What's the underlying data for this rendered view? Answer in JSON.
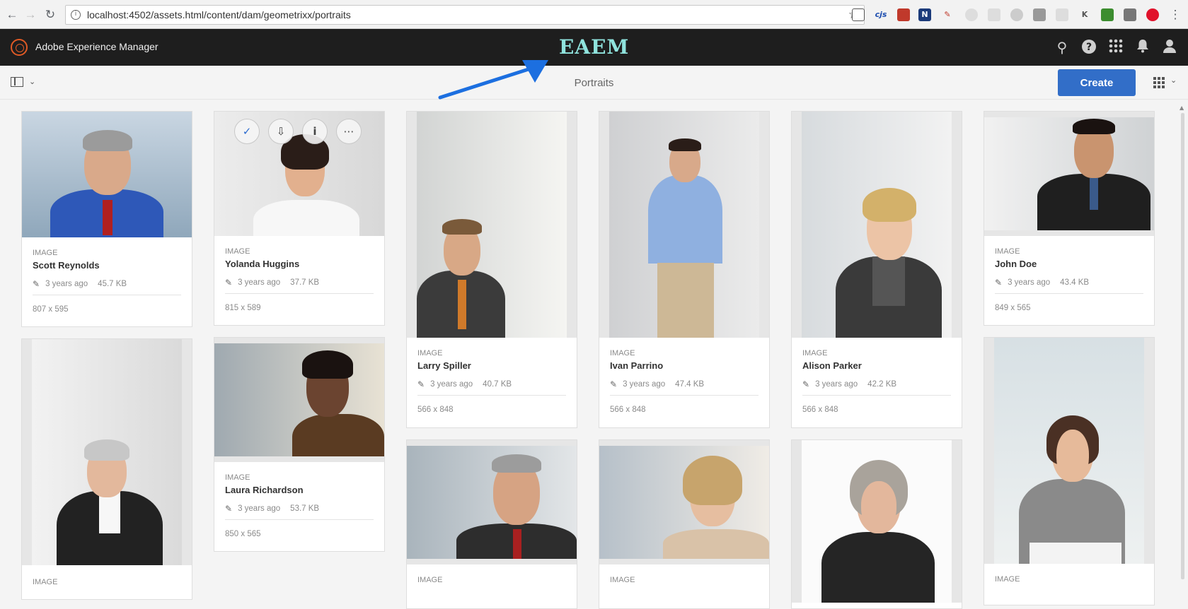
{
  "browser": {
    "url": "localhost:4502/assets.html/content/dam/geometrixx/portraits",
    "back_icon": "back-arrow-icon",
    "forward_icon": "forward-arrow-icon",
    "reload_icon": "reload-icon",
    "ext_label": "cjs"
  },
  "header": {
    "product_name": "Adobe Experience Manager",
    "badge": "EAEM"
  },
  "actionbar": {
    "title": "Portraits",
    "create_label": "Create"
  },
  "colors": {
    "header_bg": "#1e1e1e",
    "accent_blue": "#326ec8",
    "logo_orange": "#e15a25",
    "badge_teal": "#8fe3dd",
    "arrow_blue": "#1c6fe0"
  },
  "cards": [
    {
      "type": "IMAGE",
      "name": "Scott Reynolds",
      "modified": "3 years ago",
      "size": "45.7 KB",
      "dims": "807 x 595"
    },
    {
      "type": "IMAGE",
      "name": "Yolanda Huggins",
      "modified": "3 years ago",
      "size": "37.7 KB",
      "dims": "815 x 589"
    },
    {
      "type": "IMAGE",
      "name": "Larry Spiller",
      "modified": "3 years ago",
      "size": "40.7 KB",
      "dims": "566 x 848"
    },
    {
      "type": "IMAGE",
      "name": "Ivan Parrino",
      "modified": "3 years ago",
      "size": "47.4 KB",
      "dims": "566 x 848"
    },
    {
      "type": "IMAGE",
      "name": "Alison Parker",
      "modified": "3 years ago",
      "size": "42.2 KB",
      "dims": "566 x 848"
    },
    {
      "type": "IMAGE",
      "name": "John Doe",
      "modified": "3 years ago",
      "size": "43.4 KB",
      "dims": "849 x 565"
    },
    {
      "type": "IMAGE"
    },
    {
      "type": "IMAGE",
      "name": "Laura Richardson",
      "modified": "3 years ago",
      "size": "53.7 KB",
      "dims": "850 x 565"
    },
    {
      "type": "IMAGE"
    },
    {
      "type": "IMAGE"
    },
    {
      "type": "IMAGE"
    }
  ]
}
